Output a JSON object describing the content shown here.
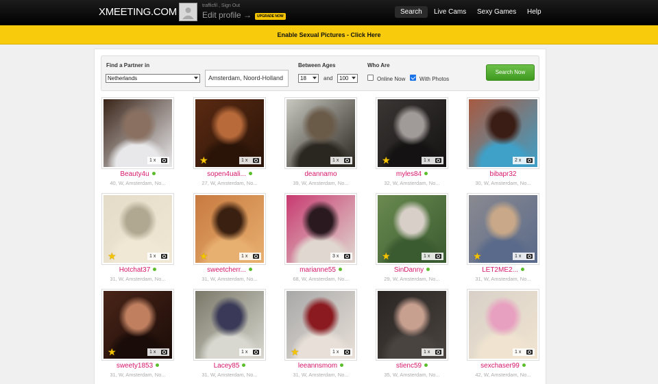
{
  "header": {
    "logo": "XMEETING.COM",
    "user_links": "trafficfil , Sign Out",
    "edit_profile": "Edit profile →",
    "upgrade": "UPGRADE NOW",
    "nav": [
      {
        "label": "Search",
        "active": true
      },
      {
        "label": "Live Cams",
        "active": false
      },
      {
        "label": "Sexy Games",
        "active": false
      },
      {
        "label": "Help",
        "active": false
      }
    ]
  },
  "banner": {
    "text": "Enable Sexual Pictures - Click Here"
  },
  "search": {
    "find_label": "Find a Partner in",
    "country": "Netherlands",
    "city": "Amsterdam, Noord-Holland",
    "ages_label": "Between Ages",
    "age_from": "18",
    "and_label": "and",
    "age_to": "100",
    "who_label": "Who Are",
    "online_now": "Online Now",
    "with_photos": "With Photos",
    "online_checked": false,
    "photos_checked": true,
    "button": "Search Now"
  },
  "profiles": [
    {
      "name": "Beauty4u",
      "meta": "40, W, Amsterdam, No...",
      "photos": "1 x",
      "star": false,
      "online": true,
      "colors": [
        "#3a2418",
        "#8a7060",
        "#e8e8ea"
      ]
    },
    {
      "name": "sopen4uali...",
      "meta": "27, W, Amsterdam, No...",
      "photos": "1 x",
      "star": true,
      "online": true,
      "colors": [
        "#5a2a12",
        "#b86a3a",
        "#2a1408"
      ]
    },
    {
      "name": "deannamo",
      "meta": "39, W, Amsterdam, No...",
      "photos": "1 x",
      "star": false,
      "online": false,
      "colors": [
        "#c8c8c0",
        "#6a5a48",
        "#2a2620"
      ]
    },
    {
      "name": "myles84",
      "meta": "32, W, Amsterdam, No...",
      "photos": "1 x",
      "star": true,
      "online": true,
      "colors": [
        "#3a3634",
        "#a09a98",
        "#141212"
      ]
    },
    {
      "name": "bibapr32",
      "meta": "30, W, Amsterdam, No...",
      "photos": "2 x",
      "star": false,
      "online": false,
      "colors": [
        "#a85a40",
        "#3a1e16",
        "#3fa0c8"
      ]
    },
    {
      "name": "Hotchat37",
      "meta": "31, W, Amsterdam, No...",
      "photos": "1 x",
      "star": true,
      "online": true,
      "colors": [
        "#e4dcc8",
        "#b0a890",
        "#f0e8d4"
      ]
    },
    {
      "name": "sweetcherr...",
      "meta": "31, W, Amsterdam, No...",
      "photos": "1 x",
      "star": true,
      "online": true,
      "colors": [
        "#c87a40",
        "#3a2010",
        "#e8b070"
      ]
    },
    {
      "name": "marianne55",
      "meta": "68, W, Amsterdam, No...",
      "photos": "3 x",
      "star": false,
      "online": true,
      "colors": [
        "#c83a70",
        "#2a1a20",
        "#e0d8d0"
      ]
    },
    {
      "name": "SinDanny",
      "meta": "29, W, Amsterdam, No...",
      "photos": "1 x",
      "star": true,
      "online": true,
      "colors": [
        "#6a8a50",
        "#d8d0c8",
        "#3a5a30"
      ]
    },
    {
      "name": "LET2ME2...",
      "meta": "31, W, Amsterdam, No...",
      "photos": "1 x",
      "star": true,
      "online": true,
      "colors": [
        "#8a8a90",
        "#c8a888",
        "#5a6a8a"
      ]
    },
    {
      "name": "sweety1853",
      "meta": "31, W, Amsterdam, No...",
      "photos": "1 x",
      "star": true,
      "online": true,
      "colors": [
        "#4a2418",
        "#c08060",
        "#1a0c08"
      ]
    },
    {
      "name": "Lacey85",
      "meta": "31, W, Amsterdam, No...",
      "photos": "1 x",
      "star": false,
      "online": true,
      "colors": [
        "#7a7868",
        "#3a3a58",
        "#d8d8d0"
      ]
    },
    {
      "name": "leeannsmom",
      "meta": "31, W, Amsterdam, No...",
      "photos": "1 x",
      "star": true,
      "online": true,
      "colors": [
        "#a8a8a8",
        "#8a1a20",
        "#e8e0d8"
      ]
    },
    {
      "name": "stienc59",
      "meta": "35, W, Amsterdam, No...",
      "photos": "1 x",
      "star": false,
      "online": true,
      "colors": [
        "#2a2422",
        "#c8a090",
        "#4a4440"
      ]
    },
    {
      "name": "sexchaser99",
      "meta": "42, W, Amsterdam, No...",
      "photos": "1 x",
      "star": false,
      "online": true,
      "colors": [
        "#d8d0c8",
        "#e8a0c0",
        "#f0e4d0"
      ]
    }
  ]
}
